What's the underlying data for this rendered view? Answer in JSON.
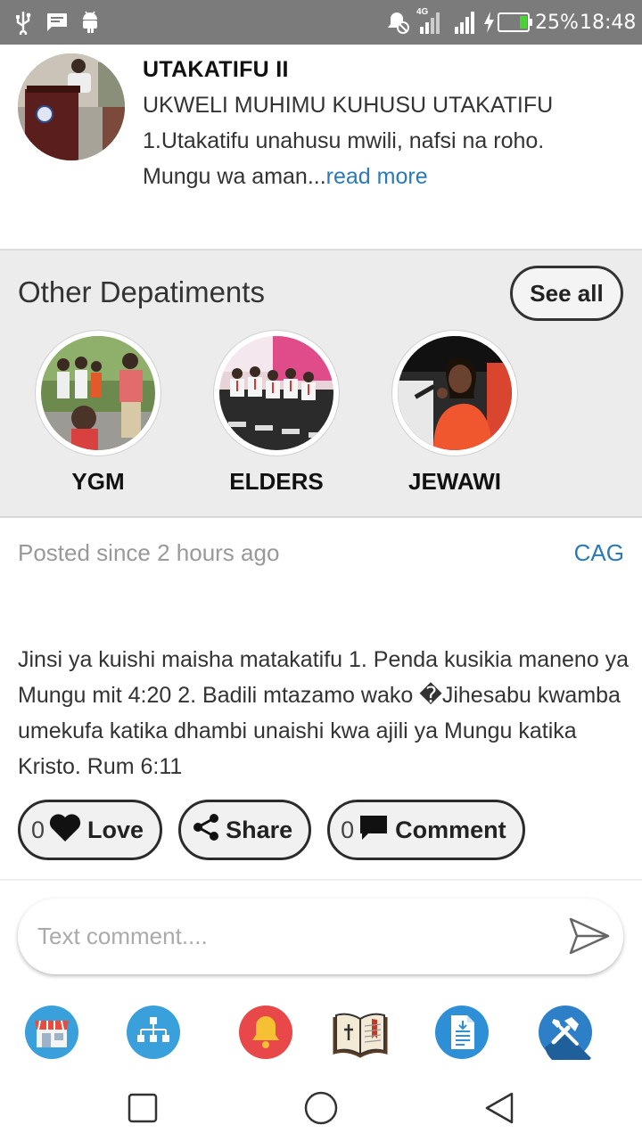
{
  "status_bar": {
    "battery": "25%",
    "time": "18:48",
    "network": "4G"
  },
  "post1": {
    "title": "UTAKATIFU II",
    "excerpt": "UKWELI MUHIMU KUHUSU UTAKATIFU 1.Utakatifu unahusu mwili, nafsi na roho. Mungu wa aman...",
    "read_more": "read more"
  },
  "departments": {
    "title": "Other Depatiments",
    "see_all": "See all",
    "items": [
      {
        "name": "YGM"
      },
      {
        "name": "ELDERS"
      },
      {
        "name": "JEWAWI"
      }
    ]
  },
  "post2": {
    "posted": "Posted since 2 hours ago",
    "author": "CAG",
    "body": "Jinsi ya kuishi maisha matakatifu 1. Penda kusikia maneno ya Mungu mit 4:20 2. Badili mtazamo wako �Jihesabu kwamba umekufa katika dhambi unaishi kwa ajili ya Mungu katika Kristo. Rum 6:11",
    "love_count": "0",
    "love_label": "Love",
    "share_label": "Share",
    "comment_count": "0",
    "comment_label": "Comment"
  },
  "comment": {
    "placeholder": "Text comment...."
  },
  "bottom_nav": [
    {
      "icon": "store-icon"
    },
    {
      "icon": "sitemap-icon"
    },
    {
      "icon": "bell-icon"
    },
    {
      "icon": "bible-icon"
    },
    {
      "icon": "document-icon"
    },
    {
      "icon": "tools-icon"
    }
  ],
  "colors": {
    "link": "#2a7ab8",
    "status_bar": "#7b7b7b",
    "section_bg": "#ececec"
  }
}
